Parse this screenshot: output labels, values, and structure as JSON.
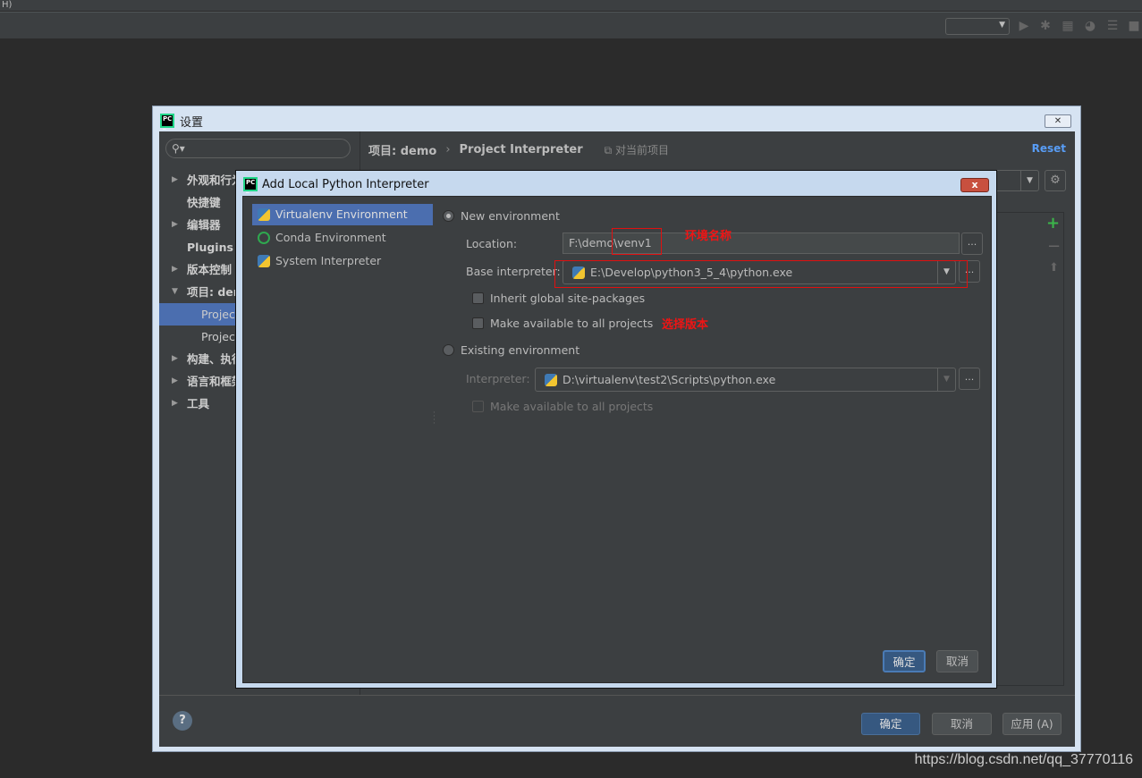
{
  "topstrip": {
    "text": "H)"
  },
  "settings": {
    "title": "设置",
    "search_placeholder": "",
    "sidebar": [
      {
        "label": "外观和行为",
        "arrow": "▶",
        "bold": true
      },
      {
        "label": "快捷键",
        "arrow": "",
        "bold": true
      },
      {
        "label": "编辑器",
        "arrow": "▶",
        "bold": true
      },
      {
        "label": "Plugins",
        "arrow": "",
        "bold": true
      },
      {
        "label": "版本控制",
        "arrow": "▶",
        "bold": true
      },
      {
        "label": "项目: demo",
        "arrow": "▼",
        "bold": true
      },
      {
        "label": "Project Interpreter",
        "arrow": "",
        "sub": true,
        "selected": true
      },
      {
        "label": "Project Structure",
        "arrow": "",
        "sub": true
      },
      {
        "label": "构建、执行、部署",
        "arrow": "▶",
        "bold": true
      },
      {
        "label": "语言和框架",
        "arrow": "▶",
        "bold": true
      },
      {
        "label": "工具",
        "arrow": "▶",
        "bold": true
      }
    ],
    "breadcrumb": [
      "项目: demo",
      "Project Interpreter"
    ],
    "breadcrumb_sep": "›",
    "scope_label": "对当前项目",
    "reset_label": "Reset",
    "ok_label": "确定",
    "cancel_label": "取消",
    "apply_label": "应用 (A)",
    "help_label": "?"
  },
  "dialog": {
    "title": "Add Local Python Interpreter",
    "close_label": "x",
    "types": [
      {
        "label": "Virtualenv Environment",
        "icon": "python-virtualenv-icon",
        "selected": true
      },
      {
        "label": "Conda Environment",
        "icon": "conda-icon"
      },
      {
        "label": "System Interpreter",
        "icon": "python-icon"
      }
    ],
    "new_env": {
      "label": "New environment",
      "selected": true,
      "location_label": "Location:",
      "location_value": "F:\\demo\\venv1",
      "base_label": "Base interpreter:",
      "base_value": "E:\\Develop\\python3_5_4\\python.exe",
      "inherit_label": "Inherit global site-packages",
      "inherit_checked": false,
      "make_available_label": "Make available to all projects",
      "make_available_checked": false
    },
    "existing_env": {
      "label": "Existing environment",
      "selected": false,
      "interpreter_label": "Interpreter:",
      "interpreter_value": "D:\\virtualenv\\test2\\Scripts\\python.exe",
      "make_available_label": "Make available to all projects"
    },
    "browse_label": "...",
    "ok_label": "确定",
    "cancel_label": "取消"
  },
  "annotations": {
    "env_name": "环境名称",
    "choose_version": "选择版本",
    "color": "#f01414"
  },
  "watermark": "https://blog.csdn.net/qq_37770116"
}
